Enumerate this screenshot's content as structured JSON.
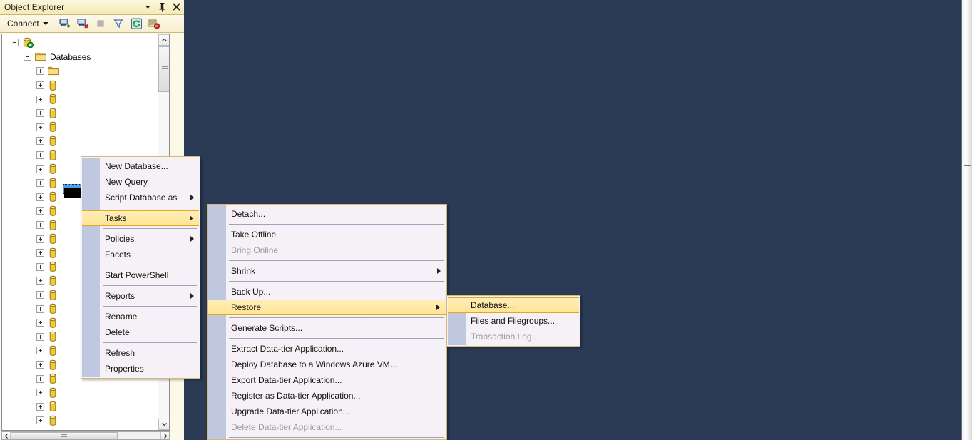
{
  "app": {
    "background_color": "#2b3a55"
  },
  "panel": {
    "title": "Object Explorer",
    "title_buttons": [
      {
        "name": "window-menu-icon",
        "label": "▾"
      },
      {
        "name": "pin-icon",
        "label": "Auto Hide"
      },
      {
        "name": "close-icon",
        "label": "Close"
      }
    ]
  },
  "toolbar": {
    "connect_label": "Connect",
    "icons": [
      {
        "name": "connect-object-explorer-icon",
        "tooltip": "Connect"
      },
      {
        "name": "disconnect-object-explorer-icon",
        "tooltip": "Disconnect"
      },
      {
        "name": "stop-icon",
        "tooltip": "Stop",
        "disabled": true
      },
      {
        "name": "filter-icon",
        "tooltip": "Filter"
      },
      {
        "name": "refresh-icon",
        "tooltip": "Refresh"
      },
      {
        "name": "disconnect-report-icon",
        "tooltip": "Disconnect"
      }
    ]
  },
  "tree": {
    "root": {
      "label": "",
      "icon": "server-icon",
      "expanded": true
    },
    "databases_node": {
      "label": "Databases",
      "icon": "folder-icon",
      "expanded": true
    },
    "system_databases_node": {
      "label": "",
      "icon": "folder-icon",
      "expanded": false
    },
    "database_rows_count": 26,
    "selected_row_index": 8,
    "selected_row_label": "",
    "scroll": {
      "vertical_thumb_position": "near-top",
      "horizontal_thumb_position": "left"
    }
  },
  "context_menu": {
    "items": [
      {
        "label": "New Database...",
        "type": "item"
      },
      {
        "label": "New Query",
        "type": "item"
      },
      {
        "label": "Script Database as",
        "type": "submenu"
      },
      {
        "type": "separator"
      },
      {
        "label": "Tasks",
        "type": "submenu",
        "highlighted": true
      },
      {
        "type": "separator"
      },
      {
        "label": "Policies",
        "type": "submenu"
      },
      {
        "label": "Facets",
        "type": "item"
      },
      {
        "type": "separator"
      },
      {
        "label": "Start PowerShell",
        "type": "item"
      },
      {
        "type": "separator"
      },
      {
        "label": "Reports",
        "type": "submenu"
      },
      {
        "type": "separator"
      },
      {
        "label": "Rename",
        "type": "item"
      },
      {
        "label": "Delete",
        "type": "item"
      },
      {
        "type": "separator"
      },
      {
        "label": "Refresh",
        "type": "item"
      },
      {
        "label": "Properties",
        "type": "item"
      }
    ]
  },
  "tasks_menu": {
    "items": [
      {
        "label": "Detach...",
        "type": "item"
      },
      {
        "type": "separator"
      },
      {
        "label": "Take Offline",
        "type": "item"
      },
      {
        "label": "Bring Online",
        "type": "item",
        "disabled": true
      },
      {
        "type": "separator"
      },
      {
        "label": "Shrink",
        "type": "submenu"
      },
      {
        "type": "separator"
      },
      {
        "label": "Back Up...",
        "type": "item"
      },
      {
        "label": "Restore",
        "type": "submenu",
        "highlighted": true
      },
      {
        "type": "separator"
      },
      {
        "label": "Generate Scripts...",
        "type": "item"
      },
      {
        "type": "separator"
      },
      {
        "label": "Extract Data-tier Application...",
        "type": "item"
      },
      {
        "label": "Deploy Database to a Windows Azure VM...",
        "type": "item"
      },
      {
        "label": "Export Data-tier Application...",
        "type": "item"
      },
      {
        "label": "Register as Data-tier Application...",
        "type": "item"
      },
      {
        "label": "Upgrade Data-tier Application...",
        "type": "item"
      },
      {
        "label": "Delete Data-tier Application...",
        "type": "item",
        "disabled": true
      },
      {
        "type": "separator"
      }
    ]
  },
  "restore_menu": {
    "items": [
      {
        "label": "Database...",
        "type": "item",
        "highlighted": true
      },
      {
        "label": "Files and Filegroups...",
        "type": "item"
      },
      {
        "label": "Transaction Log...",
        "type": "item",
        "disabled": true
      }
    ]
  },
  "colors": {
    "workspace": "#2b3a55",
    "panel_title_gradient_top": "#fdf7df",
    "panel_title_gradient_bottom": "#f6e9b2",
    "menu_background": "#f6f1f6",
    "menu_gutter": "#bfc8de",
    "menu_border": "#d3b878",
    "highlight_fill": "#ffe493",
    "highlight_border": "#e0a81e",
    "selection_blue": "#4d9fe8",
    "disabled_text": "#9a9a9a"
  }
}
